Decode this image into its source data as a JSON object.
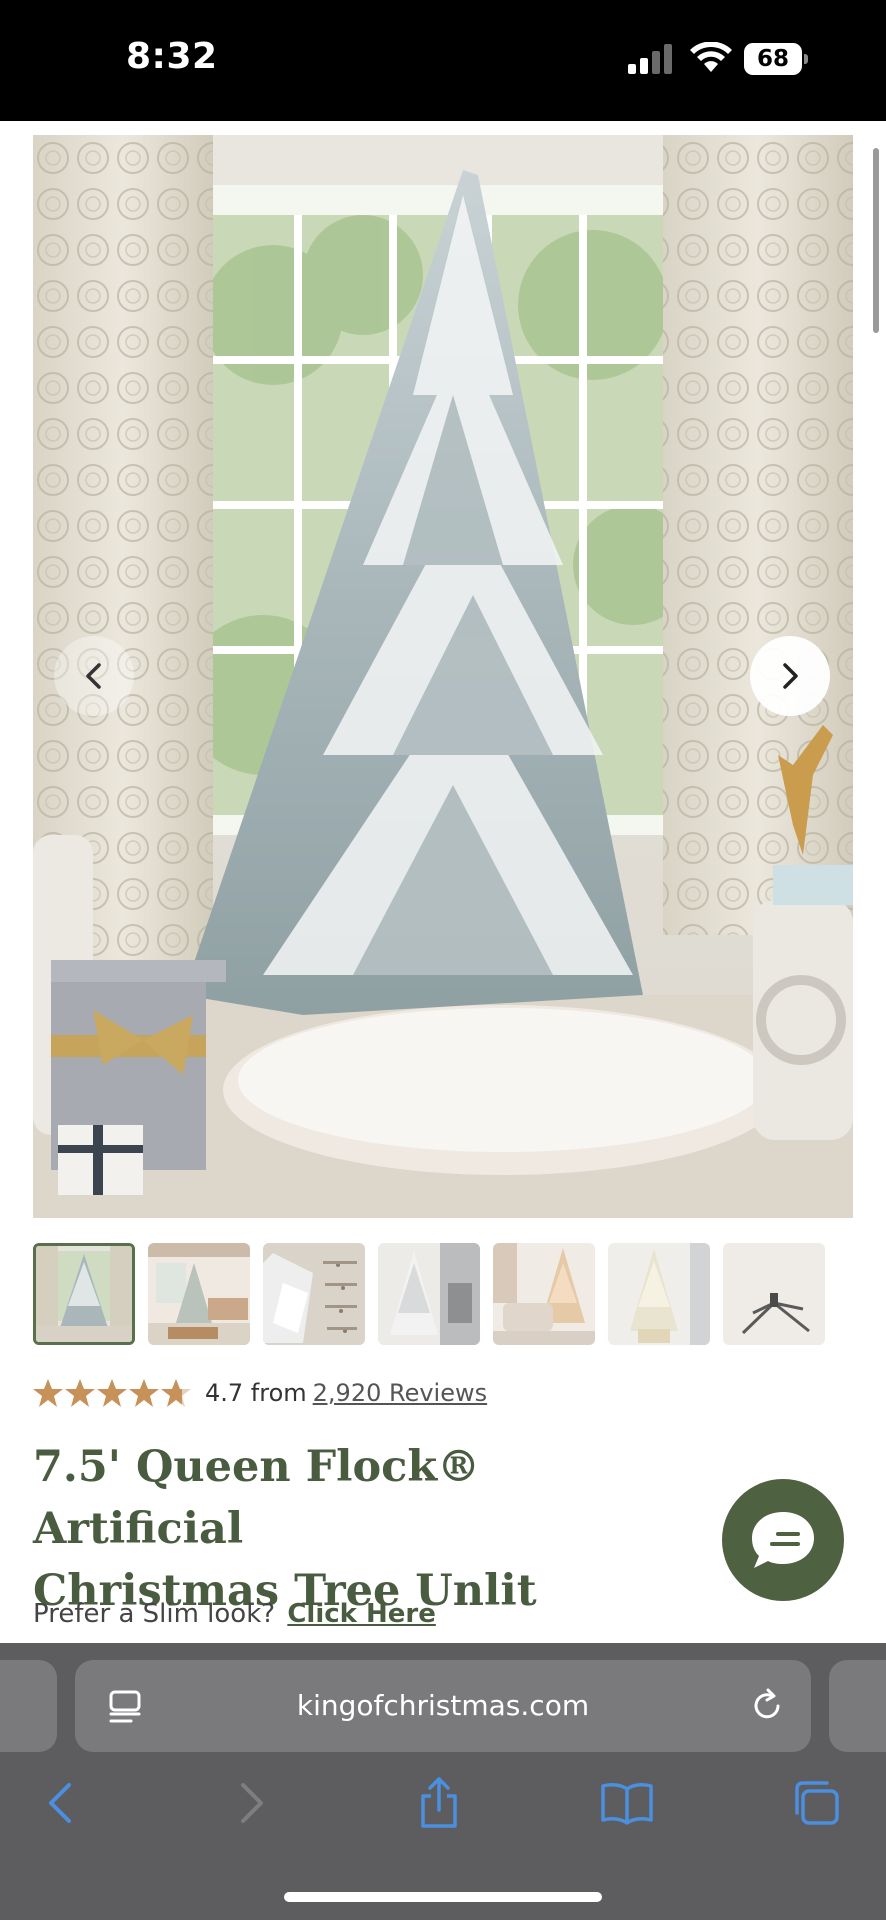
{
  "status_bar": {
    "time": "8:32",
    "battery": "68",
    "icons": [
      "signal-icon",
      "wifi-icon",
      "battery-icon"
    ]
  },
  "gallery": {
    "main_image_alt": "flocked-christmas-tree-photo",
    "prev_icon": "chevron-left-icon",
    "next_icon": "chevron-right-icon",
    "thumbnail_count": 7,
    "active_thumbnail": 1
  },
  "rating": {
    "stars": 4.7,
    "score_text": "4.7 from",
    "reviews_link": "2,920 Reviews",
    "star_color": "#c8915a"
  },
  "product": {
    "title_line1": "7.5' Queen Flock® Artificial",
    "title_line2": "Christmas Tree Unlit",
    "slim_prompt": "Prefer a Slim look?",
    "slim_link": "Click Here",
    "accent_color": "#4a5c40"
  },
  "chat": {
    "icon": "chat-bubble-icon"
  },
  "browser": {
    "url": "kingofchristmas.com",
    "toolbar_icons": [
      "back-icon",
      "forward-icon",
      "share-icon",
      "bookmarks-icon",
      "tabs-icon"
    ],
    "accent_color": "#4a8fe0"
  }
}
